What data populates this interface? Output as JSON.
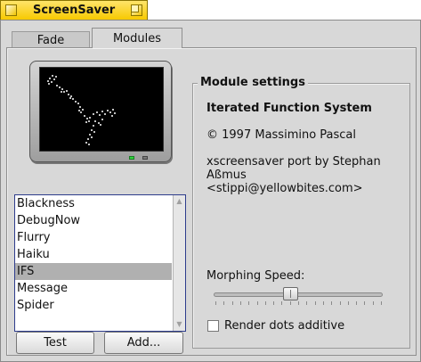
{
  "window": {
    "title": "ScreenSaver"
  },
  "tabs": [
    {
      "label": "Fade",
      "active": false
    },
    {
      "label": "Modules",
      "active": true
    }
  ],
  "module_list": {
    "items": [
      "Blackness",
      "DebugNow",
      "Flurry",
      "Haiku",
      "IFS",
      "Message",
      "Spider"
    ],
    "selected": "IFS"
  },
  "buttons": {
    "test": "Test",
    "add": "Add..."
  },
  "settings": {
    "group_label": "Module settings",
    "title": "Iterated Function System",
    "copyright": "© 1997 Massimino Pascal",
    "description": "xscreensaver port by Stephan\nAßmus\n<stippi@yellowbites.com>",
    "slider_label": "Morphing Speed:",
    "slider_value": 0.45,
    "checkbox_label": "Render dots additive",
    "checkbox_checked": false
  },
  "colors": {
    "title_tab": "#f7c900",
    "list_border": "#2d3c8c",
    "selection": "#b0b0b0",
    "led": "#2fd43c"
  }
}
